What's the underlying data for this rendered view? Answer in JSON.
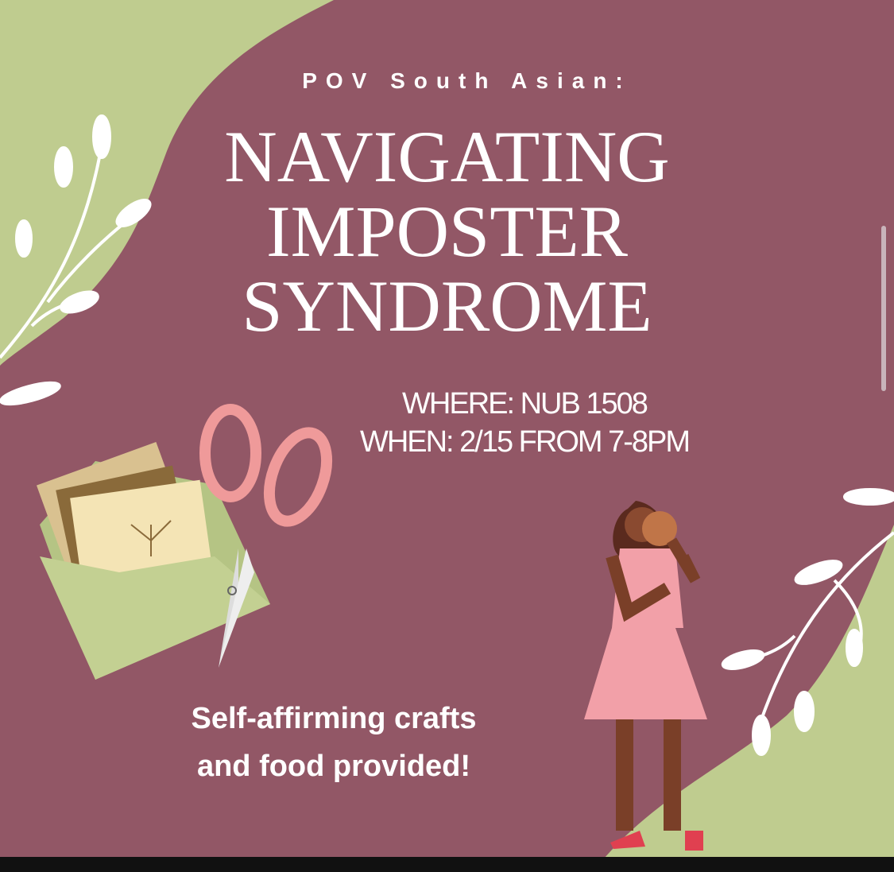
{
  "poster": {
    "kicker": "POV South Asian:",
    "title_lines": [
      "NAVIGATING",
      "IMPOSTER",
      "SYNDROME"
    ],
    "where": "WHERE: NUB 1508",
    "when": "WHEN: 2/15 FROM 7-8PM",
    "footer_lines": [
      "Self-affirming crafts",
      "and food  provided!"
    ]
  },
  "colors": {
    "background": "#925766",
    "accent_green": "#bfcc8f",
    "text": "#ffffff"
  }
}
